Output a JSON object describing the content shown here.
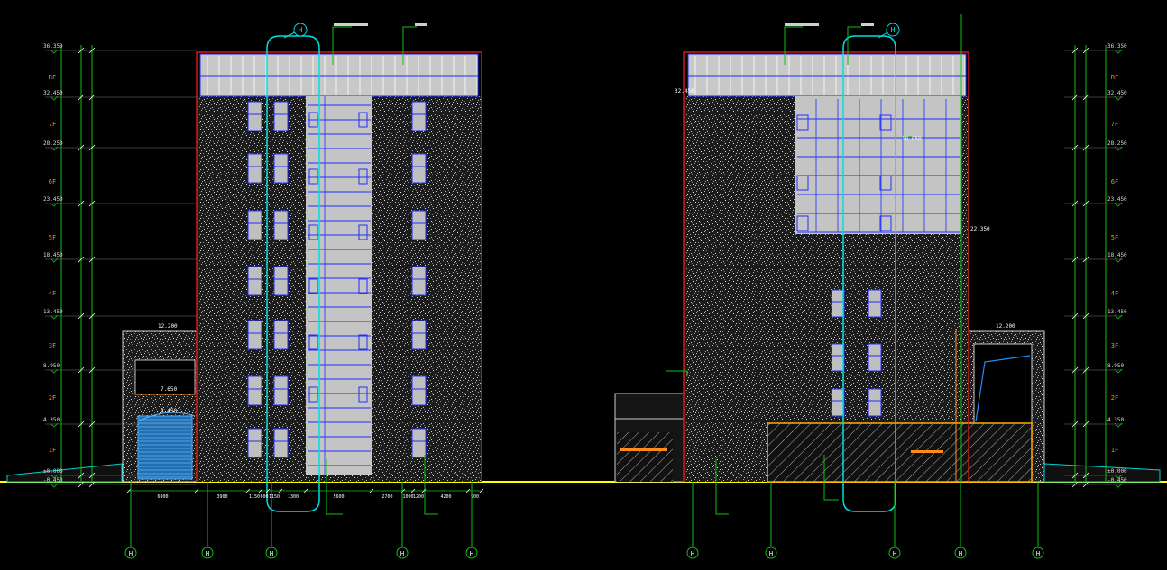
{
  "colors": {
    "background": "#000000",
    "ground": "#ffff00",
    "outline": "#d01818",
    "grid": "#10c010",
    "glass": "#bfbfbf",
    "mullion": "#2030ff",
    "callout": "#00e0e0",
    "level_text": "#ff8c1a",
    "dim_text": "#ffffff",
    "hatch": "#e0e0e0",
    "leader": "#d0d0d0"
  },
  "left_elevation": {
    "floor_labels": [
      "RF",
      "7F",
      "6F",
      "5F",
      "4F",
      "3F",
      "2F",
      "1F"
    ],
    "elevations": [
      "36.350",
      "32.450",
      "28.250",
      "23.450",
      "18.450",
      "13.450",
      "8.950",
      "4.350",
      "±0.000",
      "-0.450"
    ],
    "bottom_dims": [
      "6900",
      "3900",
      "1150",
      "600",
      "1150",
      "1300",
      "5600",
      "2700",
      "1000",
      "1200",
      "4200",
      "900"
    ],
    "grid_axes": [
      "H",
      "H",
      "H",
      "H",
      "H"
    ],
    "top_callout": "H",
    "annotations": [
      "12.200",
      "7.650",
      "4.450"
    ]
  },
  "right_elevation": {
    "floor_labels": [
      "RF",
      "7F",
      "6F",
      "5F",
      "4F",
      "3F",
      "2F",
      "1F"
    ],
    "elevations": [
      "36.350",
      "32.450",
      "28.250",
      "23.450",
      "18.450",
      "13.450",
      "8.950",
      "4.350",
      "±0.000",
      "-0.450"
    ],
    "grid_axes": [
      "H",
      "H",
      "H",
      "H",
      "H"
    ],
    "top_callout": "H",
    "annotations": [
      "32.450",
      "18.850",
      "12.200",
      "22.350"
    ]
  }
}
